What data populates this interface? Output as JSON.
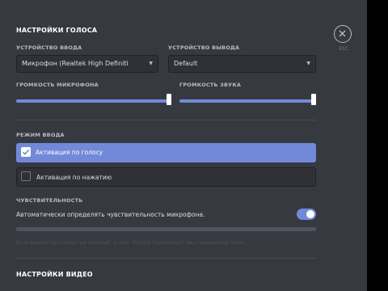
{
  "voice_settings": {
    "title": "НАСТРОЙКИ ГОЛОСА",
    "input_device": {
      "label": "УСТРОЙСТВО ВВОДА",
      "value": "Микрофон (Realtek High Definiti"
    },
    "output_device": {
      "label": "УСТРОЙСТВО ВЫВОДА",
      "value": "Default"
    },
    "input_volume": {
      "label": "ГРОМКОСТЬ МИКРОФОНА",
      "level": 1.0
    },
    "output_volume": {
      "label": "ГРОМКОСТЬ ЗВУКА",
      "level": 1.0
    }
  },
  "input_mode": {
    "label": "РЕЖИМ ВВОДА",
    "options": [
      {
        "label": "Активация по голосу",
        "selected": true
      },
      {
        "label": "Активация по нажатию",
        "selected": false
      }
    ]
  },
  "sensitivity": {
    "label": "ЧУВСТВИТЕЛЬНОСТЬ",
    "auto_label": "Автоматически определять чувствительность микрофона.",
    "auto_enabled": true,
    "hint": "Если индикатор полностью зеленый, значит Discord транслирует ваш прекрасный голос."
  },
  "video_settings": {
    "title": "НАСТРОЙКИ ВИДЕО"
  },
  "close": {
    "label": "ESC",
    "icon": "close-icon"
  },
  "colors": {
    "accent": "#7289da",
    "background": "#36393f",
    "input_bg": "#2f3136"
  }
}
